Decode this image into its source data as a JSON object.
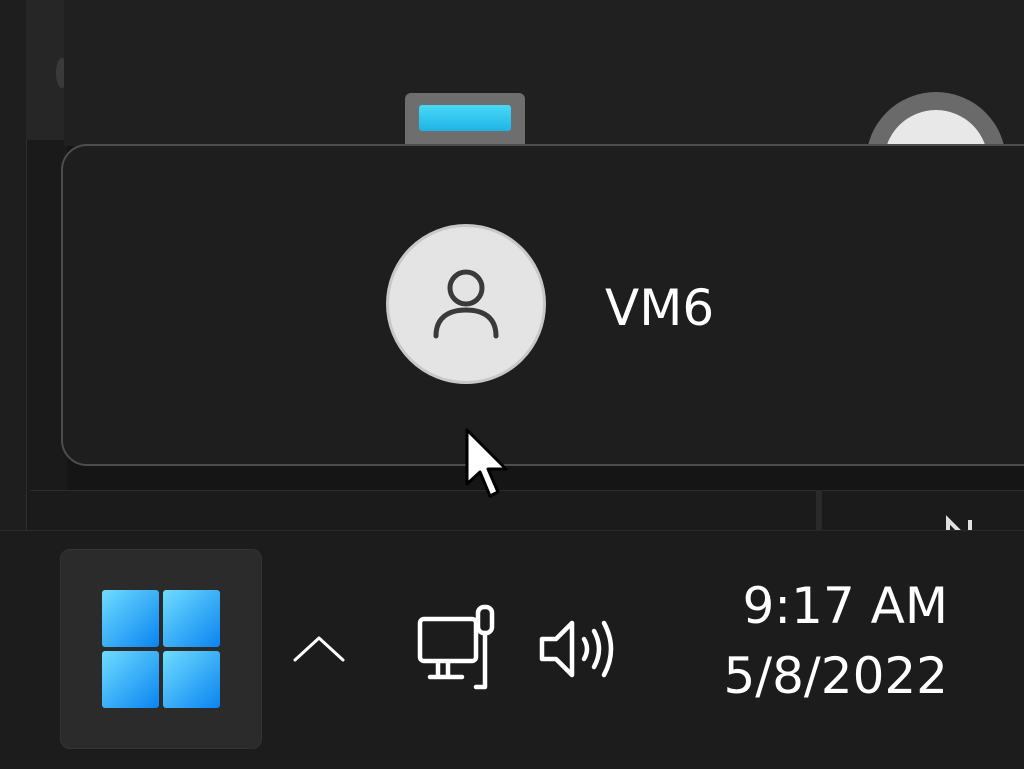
{
  "account": {
    "name": "VM6",
    "avatar_icon": "person-icon"
  },
  "taskbar": {
    "start_icon": "windows-logo-icon",
    "tray_overflow_icon": "chevron-up-icon",
    "network_icon": "wired-network-icon",
    "volume_icon": "speaker-volume-icon",
    "clock": {
      "time": "9:17 AM",
      "date": "5/8/2022"
    }
  },
  "colors": {
    "accent": "#1fb4e6",
    "taskbar_bg": "#1c1c1c",
    "panel_bg": "#1e1e1e",
    "text": "#ffffff"
  }
}
